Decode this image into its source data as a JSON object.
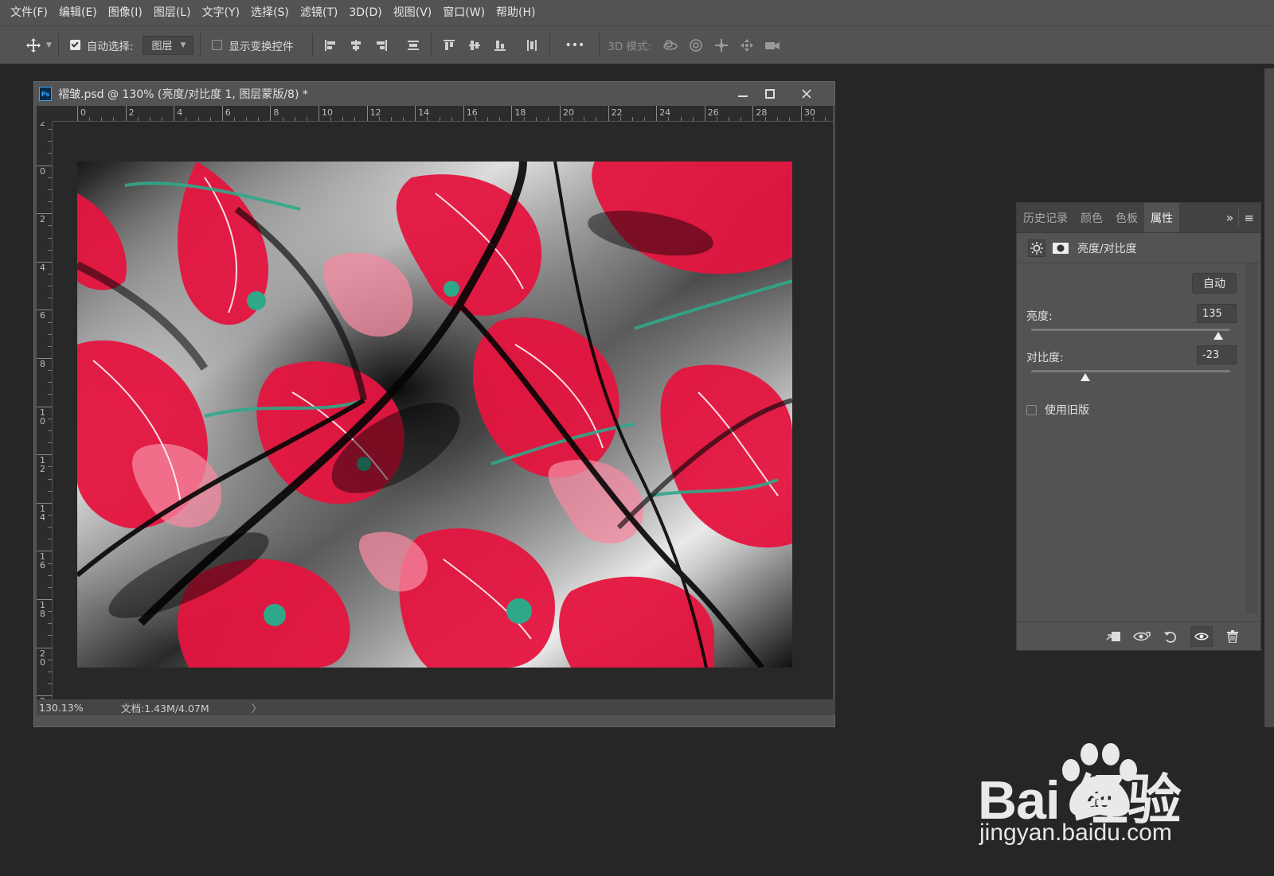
{
  "menu": [
    "文件(F)",
    "编辑(E)",
    "图像(I)",
    "图层(L)",
    "文字(Y)",
    "选择(S)",
    "滤镜(T)",
    "3D(D)",
    "视图(V)",
    "窗口(W)",
    "帮助(H)"
  ],
  "options": {
    "auto_select_label": "自动选择:",
    "auto_select_checked": true,
    "auto_select_target": "图层",
    "show_transform_label": "显示变换控件",
    "show_transform_checked": false,
    "more_label": "•••",
    "mode_3d_label": "3D 模式:"
  },
  "document": {
    "title": "褶皱.psd @ 130% (亮度/对比度 1, 图层蒙版/8) *",
    "ps_badge": "Ps",
    "ruler_h": [
      "0",
      "2",
      "4",
      "6",
      "8",
      "10",
      "12",
      "14",
      "16",
      "18",
      "20",
      "22",
      "24",
      "26",
      "28",
      "30"
    ],
    "ruler_v": [
      "2",
      "0",
      "2",
      "4",
      "6",
      "8",
      "10",
      "12",
      "14",
      "16",
      "18",
      "20",
      "22"
    ],
    "zoom": "130.13%",
    "doc_size": "文档:1.43M/4.07M",
    "status_arrow": "〉",
    "image_desc": "draped satin fabric with red poppy print"
  },
  "panel": {
    "tabs": [
      "历史记录",
      "颜色",
      "色板",
      "属性"
    ],
    "active_tab": "属性",
    "expand_glyph": "»",
    "menu_glyph": "≡",
    "adjustment_title": "亮度/对比度",
    "auto_label": "自动",
    "brightness_label": "亮度:",
    "brightness_value": "135",
    "brightness_pct": 0.94,
    "contrast_label": "对比度:",
    "contrast_value": "-23",
    "contrast_pct": 0.27,
    "use_legacy_label": "使用旧版",
    "use_legacy_checked": false
  },
  "watermark": {
    "brand": "Bai 经验",
    "url": "jingyan.baidu.com"
  },
  "colors": {
    "app_bg": "#262626",
    "chrome": "#535353",
    "fabric_red": "#e5153f",
    "fabric_teal": "#2fa88a",
    "ps_blue": "#31a8ff"
  }
}
